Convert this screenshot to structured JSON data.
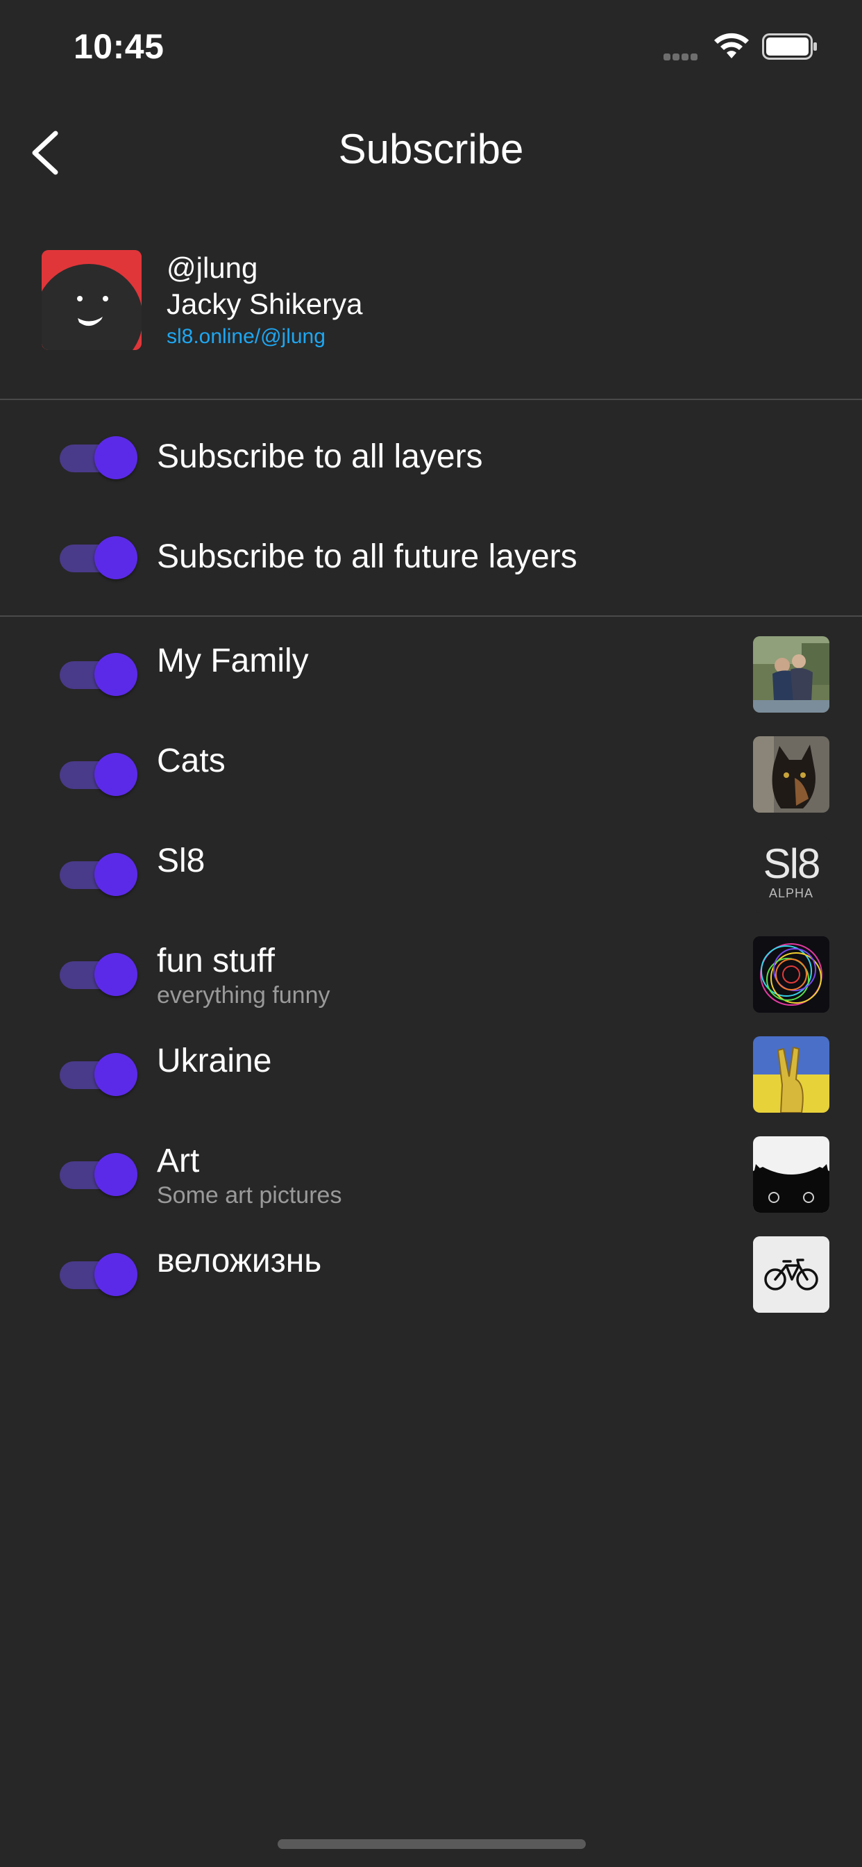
{
  "status_bar": {
    "time": "10:45"
  },
  "nav": {
    "title": "Subscribe"
  },
  "profile": {
    "handle": "@jlung",
    "name": "Jacky Shikerya",
    "link": "sl8.online/@jlung"
  },
  "global_toggles": [
    {
      "label": "Subscribe to all layers",
      "on": true
    },
    {
      "label": "Subscribe to all future layers",
      "on": true
    }
  ],
  "layers": [
    {
      "label": "My Family",
      "subtitle": "",
      "on": true,
      "thumb": "family-photo"
    },
    {
      "label": "Cats",
      "subtitle": "",
      "on": true,
      "thumb": "cat-photo"
    },
    {
      "label": "Sl8",
      "subtitle": "",
      "on": true,
      "thumb": "sl8-logo",
      "logo_text": "Sl8",
      "logo_sub": "ALPHA"
    },
    {
      "label": "fun stuff",
      "subtitle": "everything funny",
      "on": true,
      "thumb": "spiral-art"
    },
    {
      "label": "Ukraine",
      "subtitle": "",
      "on": true,
      "thumb": "ukraine-peace-hand"
    },
    {
      "label": "Art",
      "subtitle": "Some art pictures",
      "on": true,
      "thumb": "black-cat-art"
    },
    {
      "label": "веложизнь",
      "subtitle": "",
      "on": true,
      "thumb": "bicycle-icon"
    }
  ],
  "colors": {
    "background": "#272727",
    "accent": "#5b2ae8",
    "track": "#4a3a8a",
    "link": "#1ea7f2"
  }
}
